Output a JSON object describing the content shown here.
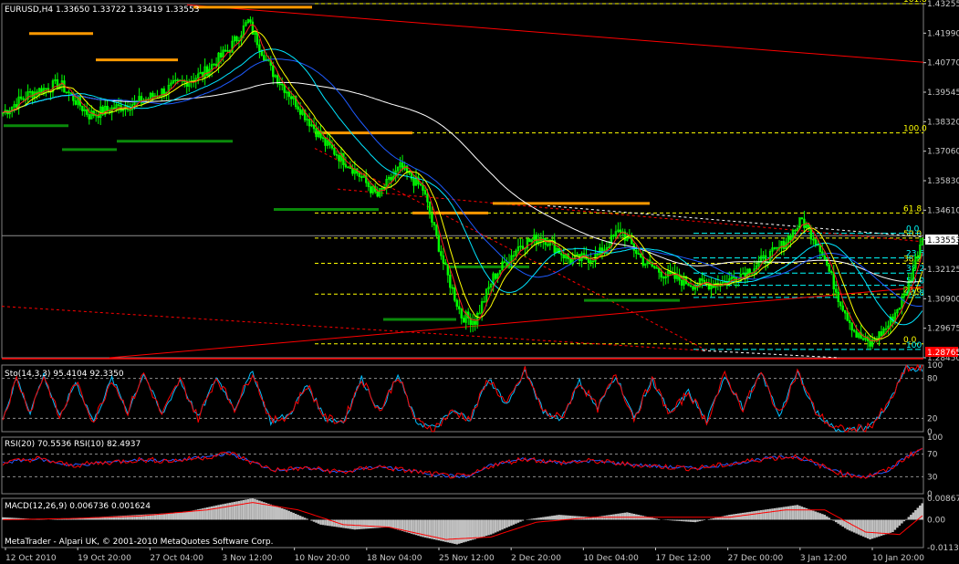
{
  "header": {
    "symbol_line": "EURUSD,H4  1.33650 1.33722 1.33419 1.33553"
  },
  "current_price": "1.33553",
  "support_box": "1.28765",
  "price_axis": [
    "1.43255",
    "1.41990",
    "1.40770",
    "1.39545",
    "1.38320",
    "1.37060",
    "1.35830",
    "1.34610",
    "1.33355",
    "1.32125",
    "1.30900",
    "1.29675",
    "1.28450"
  ],
  "fib_levels": {
    "big_fib": [
      {
        "label": "161.8",
        "value": 1.4325
      },
      {
        "label": "100.0",
        "value": 1.3785
      },
      {
        "label": "61.8",
        "value": 1.345
      },
      {
        "label": "50.0",
        "value": 1.3345
      },
      {
        "label": "38.2",
        "value": 1.324
      },
      {
        "label": "23.6",
        "value": 1.3111
      },
      {
        "label": "0.0",
        "value": 1.2903
      }
    ],
    "small_fib": [
      {
        "label": "0.0",
        "value": 1.3365
      },
      {
        "label": "23.6",
        "value": 1.3262
      },
      {
        "label": "38.2",
        "value": 1.3199
      },
      {
        "label": "50.0",
        "value": 1.3148
      },
      {
        "label": "61.8",
        "value": 1.3097
      },
      {
        "label": "100",
        "value": 1.288
      }
    ]
  },
  "indicators": {
    "stoch": {
      "label": "Sto(14,3,3) 95.4104 92.3350",
      "levels": [
        "100",
        "80",
        "20",
        "0"
      ]
    },
    "rsi": {
      "label": "RSI(20) 70.5536  RSI(10) 82.4937",
      "levels": [
        "100",
        "70",
        "30",
        "0"
      ]
    },
    "macd": {
      "label": "MACD(12,26,9) 0.006736 0.001624",
      "levels": [
        "0.00867",
        "0.00",
        "-0.01130"
      ]
    }
  },
  "footer": "MetaTrader - Alpari UK, © 2001-2010 MetaQuotes Software Corp.",
  "time_axis": [
    "12 Oct 2010",
    "19 Oct 20:00",
    "27 Oct 04:00",
    "3 Nov 12:00",
    "10 Nov 20:00",
    "18 Nov 04:00",
    "25 Nov 12:00",
    "2 Dec 20:00",
    "10 Dec 04:00",
    "17 Dec 12:00",
    "27 Dec 00:00",
    "3 Jan 12:00",
    "10 Jan 20:00"
  ],
  "colors": {
    "bg": "#000000",
    "candle": "#00ff00",
    "fib_yellow": "#ffff00",
    "fib_cyan": "#00ffff",
    "trend_red": "#ff0000",
    "macd_hist": "#c0c0c0",
    "sto_main": "#ff0000",
    "sto_signal": "#00bfff",
    "ma_white": "#ffffff",
    "ma_blue": "#1e5bff",
    "ma_cyan": "#00e5ff",
    "ma_yellow": "#ffff00",
    "ma_red": "#ff2020"
  },
  "chart_data": {
    "type": "line",
    "title": "EURUSD,H4",
    "x": [
      "12 Oct 2010",
      "19 Oct 20:00",
      "27 Oct 04:00",
      "3 Nov 12:00",
      "10 Nov 20:00",
      "18 Nov 04:00",
      "25 Nov 12:00",
      "2 Dec 20:00",
      "10 Dec 04:00",
      "17 Dec 12:00",
      "27 Dec 00:00",
      "3 Jan 12:00",
      "10 Jan 20:00"
    ],
    "series": [
      {
        "values": [
          1.387,
          1.395,
          1.392,
          1.415,
          1.385,
          1.363,
          1.302,
          1.334,
          1.33,
          1.318,
          1.333,
          1.302,
          1.3355
        ]
      }
    ],
    "ylim": [
      1.2845,
      1.4325
    ],
    "close_anchors": [
      [
        0,
        1.387
      ],
      [
        12,
        1.395
      ],
      [
        25,
        1.399
      ],
      [
        38,
        1.386
      ],
      [
        50,
        1.389
      ],
      [
        62,
        1.392
      ],
      [
        75,
        1.398
      ],
      [
        88,
        1.403
      ],
      [
        100,
        1.414
      ],
      [
        108,
        1.425
      ],
      [
        118,
        1.405
      ],
      [
        130,
        1.39
      ],
      [
        142,
        1.374
      ],
      [
        155,
        1.363
      ],
      [
        165,
        1.352
      ],
      [
        175,
        1.364
      ],
      [
        185,
        1.355
      ],
      [
        195,
        1.321
      ],
      [
        202,
        1.302
      ],
      [
        208,
        1.3
      ],
      [
        216,
        1.318
      ],
      [
        228,
        1.332
      ],
      [
        238,
        1.335
      ],
      [
        250,
        1.325
      ],
      [
        262,
        1.327
      ],
      [
        272,
        1.338
      ],
      [
        282,
        1.325
      ],
      [
        292,
        1.319
      ],
      [
        305,
        1.315
      ],
      [
        318,
        1.316
      ],
      [
        330,
        1.322
      ],
      [
        342,
        1.33
      ],
      [
        352,
        1.342
      ],
      [
        360,
        1.331
      ],
      [
        368,
        1.31
      ],
      [
        376,
        1.294
      ],
      [
        382,
        1.29
      ],
      [
        390,
        1.298
      ],
      [
        398,
        1.312
      ],
      [
        405,
        1.3355
      ]
    ],
    "stoch_anchors": [
      [
        0,
        20
      ],
      [
        6,
        80
      ],
      [
        12,
        30
      ],
      [
        18,
        85
      ],
      [
        25,
        20
      ],
      [
        32,
        75
      ],
      [
        40,
        15
      ],
      [
        48,
        80
      ],
      [
        55,
        30
      ],
      [
        62,
        88
      ],
      [
        70,
        25
      ],
      [
        78,
        78
      ],
      [
        86,
        20
      ],
      [
        94,
        82
      ],
      [
        102,
        35
      ],
      [
        110,
        90
      ],
      [
        118,
        15
      ],
      [
        126,
        25
      ],
      [
        134,
        70
      ],
      [
        142,
        20
      ],
      [
        150,
        15
      ],
      [
        158,
        80
      ],
      [
        166,
        30
      ],
      [
        174,
        85
      ],
      [
        182,
        15
      ],
      [
        190,
        5
      ],
      [
        198,
        30
      ],
      [
        206,
        20
      ],
      [
        214,
        80
      ],
      [
        222,
        40
      ],
      [
        230,
        92
      ],
      [
        238,
        30
      ],
      [
        246,
        20
      ],
      [
        254,
        75
      ],
      [
        262,
        35
      ],
      [
        270,
        85
      ],
      [
        278,
        20
      ],
      [
        286,
        78
      ],
      [
        294,
        25
      ],
      [
        302,
        60
      ],
      [
        310,
        15
      ],
      [
        318,
        85
      ],
      [
        326,
        35
      ],
      [
        334,
        88
      ],
      [
        342,
        25
      ],
      [
        350,
        90
      ],
      [
        358,
        30
      ],
      [
        366,
        5
      ],
      [
        374,
        2
      ],
      [
        382,
        8
      ],
      [
        390,
        40
      ],
      [
        398,
        95
      ],
      [
        405,
        95
      ]
    ],
    "rsi_anchors": [
      [
        0,
        55
      ],
      [
        15,
        62
      ],
      [
        30,
        50
      ],
      [
        45,
        55
      ],
      [
        60,
        60
      ],
      [
        75,
        58
      ],
      [
        90,
        65
      ],
      [
        100,
        72
      ],
      [
        110,
        55
      ],
      [
        120,
        42
      ],
      [
        135,
        45
      ],
      [
        150,
        38
      ],
      [
        165,
        48
      ],
      [
        180,
        40
      ],
      [
        195,
        32
      ],
      [
        205,
        30
      ],
      [
        215,
        50
      ],
      [
        230,
        62
      ],
      [
        245,
        55
      ],
      [
        260,
        58
      ],
      [
        275,
        52
      ],
      [
        290,
        48
      ],
      [
        305,
        45
      ],
      [
        320,
        52
      ],
      [
        335,
        62
      ],
      [
        350,
        66
      ],
      [
        360,
        50
      ],
      [
        370,
        35
      ],
      [
        380,
        30
      ],
      [
        390,
        42
      ],
      [
        398,
        65
      ],
      [
        405,
        80
      ]
    ],
    "macd_anchors": [
      [
        0,
        0.001
      ],
      [
        20,
        0.0
      ],
      [
        40,
        0.001
      ],
      [
        60,
        0.002
      ],
      [
        80,
        0.003
      ],
      [
        95,
        0.006
      ],
      [
        110,
        0.0087
      ],
      [
        125,
        0.004
      ],
      [
        140,
        -0.002
      ],
      [
        155,
        -0.004
      ],
      [
        170,
        -0.003
      ],
      [
        185,
        -0.007
      ],
      [
        200,
        -0.01
      ],
      [
        215,
        -0.006
      ],
      [
        230,
        0.0
      ],
      [
        245,
        0.002
      ],
      [
        260,
        0.001
      ],
      [
        275,
        0.003
      ],
      [
        290,
        0.0
      ],
      [
        305,
        -0.001
      ],
      [
        320,
        0.002
      ],
      [
        335,
        0.004
      ],
      [
        350,
        0.006
      ],
      [
        362,
        0.002
      ],
      [
        372,
        -0.004
      ],
      [
        382,
        -0.008
      ],
      [
        392,
        -0.005
      ],
      [
        400,
        0.002
      ],
      [
        405,
        0.0067
      ]
    ],
    "macd_signal_anchors": [
      [
        0,
        0.0
      ],
      [
        30,
        0.0005
      ],
      [
        60,
        0.0015
      ],
      [
        90,
        0.004
      ],
      [
        110,
        0.007
      ],
      [
        130,
        0.004
      ],
      [
        150,
        -0.002
      ],
      [
        170,
        -0.003
      ],
      [
        195,
        -0.008
      ],
      [
        215,
        -0.007
      ],
      [
        235,
        -0.001
      ],
      [
        260,
        0.001
      ],
      [
        290,
        0.001
      ],
      [
        320,
        0.001
      ],
      [
        345,
        0.004
      ],
      [
        362,
        0.004
      ],
      [
        380,
        -0.005
      ],
      [
        395,
        -0.006
      ],
      [
        405,
        0.0016
      ]
    ]
  }
}
